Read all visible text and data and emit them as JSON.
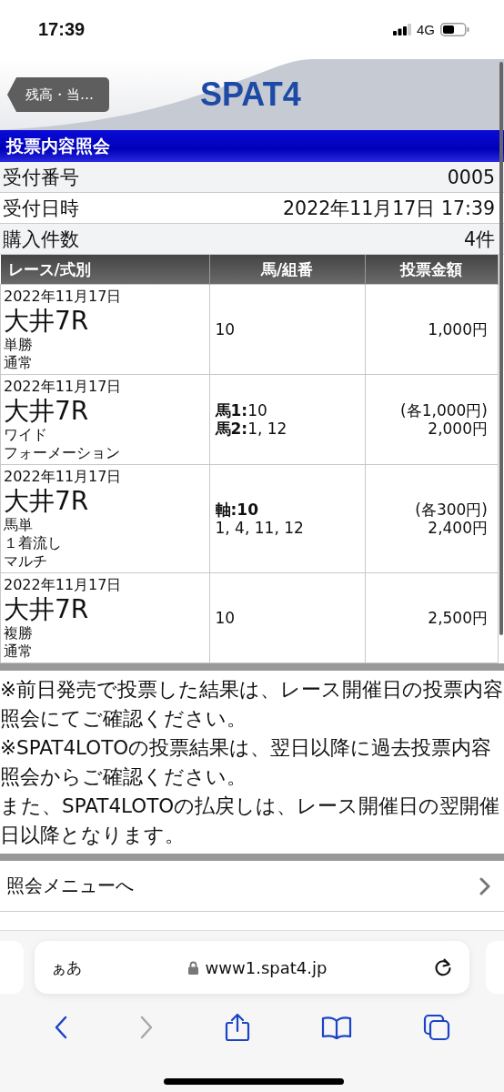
{
  "status_bar": {
    "time": "17:39",
    "network": "4G"
  },
  "header": {
    "back_button": "残高・当…",
    "logo": "SPAT4"
  },
  "title": "投票内容照会",
  "info_rows": [
    {
      "label": "受付番号",
      "value": "0005"
    },
    {
      "label": "受付日時",
      "value": "2022年11月17日 17:39"
    },
    {
      "label": "購入件数",
      "value": "4件"
    }
  ],
  "table": {
    "columns": [
      "レース/式別",
      "馬/組番",
      "投票金額"
    ],
    "rows": [
      {
        "date": "2022年11月17日",
        "race": "大井7R",
        "bet_lines": [
          "単勝",
          "通常"
        ],
        "horse_lines": [
          {
            "text": "10",
            "bold": false
          }
        ],
        "amount_lines": [
          "1,000円"
        ]
      },
      {
        "date": "2022年11月17日",
        "race": "大井7R",
        "bet_lines": [
          "ワイド",
          "フォーメーション"
        ],
        "horse_lines": [
          {
            "text": "**馬1:**10",
            "bold": false
          },
          {
            "text": "**馬2:**1, 12",
            "bold": false
          }
        ],
        "amount_lines": [
          "(各1,000円)",
          "2,000円"
        ]
      },
      {
        "date": "2022年11月17日",
        "race": "大井7R",
        "bet_lines": [
          "馬単",
          "１着流し",
          "マルチ"
        ],
        "horse_lines": [
          {
            "text": "軸:10",
            "bold": true
          },
          {
            "text": "1, 4, 11, 12",
            "bold": false
          }
        ],
        "amount_lines": [
          "(各300円)",
          "2,400円"
        ]
      },
      {
        "date": "2022年11月17日",
        "race": "大井7R",
        "bet_lines": [
          "複勝",
          "通常"
        ],
        "horse_lines": [
          {
            "text": "10",
            "bold": false
          }
        ],
        "amount_lines": [
          "2,500円"
        ]
      }
    ]
  },
  "notes": [
    "※前日発売で投票した結果は、レース開催日の投票内容照会にてご確認ください。",
    "※SPAT4LOTOの投票結果は、翌日以降に過去投票内容照会からご確認ください。",
    "また、SPAT4LOTOの払戻しは、レース開催日の翌開催日以降となります。"
  ],
  "menu": [
    "照会メニューへ"
  ],
  "browser": {
    "text_size": "ぁあ",
    "url": "www1.spat4.jp",
    "forward_disabled": true
  }
}
